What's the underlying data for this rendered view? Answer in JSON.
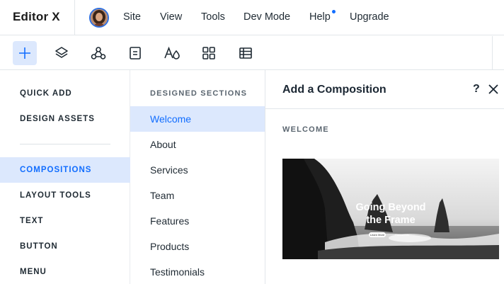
{
  "app": {
    "logo_text": "Editor",
    "logo_mark": "X"
  },
  "top_menu": {
    "items": [
      "Site",
      "View",
      "Tools",
      "Dev Mode",
      "Help",
      "Upgrade"
    ],
    "help_has_notification": true
  },
  "toolbar": {
    "tools": [
      {
        "icon": "plus-icon",
        "active": true
      },
      {
        "icon": "layers-icon",
        "active": false
      },
      {
        "icon": "apps-connect-icon",
        "active": false
      },
      {
        "icon": "pages-icon",
        "active": false
      },
      {
        "icon": "theme-icon",
        "active": false
      },
      {
        "icon": "grid-icon",
        "active": false
      },
      {
        "icon": "table-icon",
        "active": false
      }
    ]
  },
  "categories": {
    "group1": [
      "QUICK ADD",
      "DESIGN ASSETS"
    ],
    "group2": [
      "COMPOSITIONS",
      "LAYOUT TOOLS",
      "TEXT",
      "BUTTON",
      "MENU"
    ],
    "active": "COMPOSITIONS"
  },
  "sections_panel": {
    "heading": "DESIGNED SECTIONS",
    "items": [
      "Welcome",
      "About",
      "Services",
      "Team",
      "Features",
      "Products",
      "Testimonials"
    ],
    "active": "Welcome"
  },
  "composition_panel": {
    "title": "Add a Composition",
    "help_label": "?",
    "subheading": "WELCOME",
    "thumbnail": {
      "title_line1": "Going Beyond",
      "title_line2": "the Frame",
      "button_label": "Learn More",
      "link_label": "Contact Us"
    }
  },
  "colors": {
    "accent": "#116dff",
    "active_bg": "#dce8fd",
    "text": "#1f2a33"
  }
}
